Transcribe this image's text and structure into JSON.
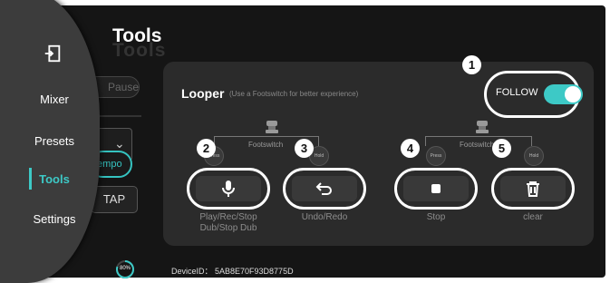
{
  "sidebar": {
    "items": [
      {
        "label": "Mixer"
      },
      {
        "label": "Presets"
      },
      {
        "label": "Tools",
        "active": true
      },
      {
        "label": "Settings"
      }
    ],
    "exit_icon": "exit-door-icon"
  },
  "background_controls": {
    "pause_label": "Pause",
    "tempo_label": "tempo",
    "tap_label": "TAP"
  },
  "page": {
    "title": "Tools"
  },
  "looper": {
    "title": "Looper",
    "hint": "(Use a Footswitch for better experience)",
    "follow_label": "FOLLOW",
    "follow_on": true,
    "footswitch_label": "Footswitch",
    "press_label": "Press",
    "hold_label": "Hold",
    "badges": [
      "1",
      "2",
      "3",
      "4",
      "5"
    ],
    "buttons": [
      {
        "icon": "microphone-icon",
        "caption_line1": "Play/Rec/Stop",
        "caption_line2": "Dub/Stop Dub"
      },
      {
        "icon": "undo-arrow-icon",
        "caption_line1": "Undo/Redo",
        "caption_line2": ""
      },
      {
        "icon": "stop-square-icon",
        "caption_line1": "Stop",
        "caption_line2": ""
      },
      {
        "icon": "trash-icon",
        "caption_line1": "clear",
        "caption_line2": ""
      }
    ]
  },
  "status": {
    "battery_percent": "80%",
    "battery_value": 0.8,
    "device_id": "DeviceID： 5AB8E70F93D8775D"
  },
  "colors": {
    "accent": "#3dc9c6",
    "background": "#151515",
    "card": "#2b2b2b"
  }
}
